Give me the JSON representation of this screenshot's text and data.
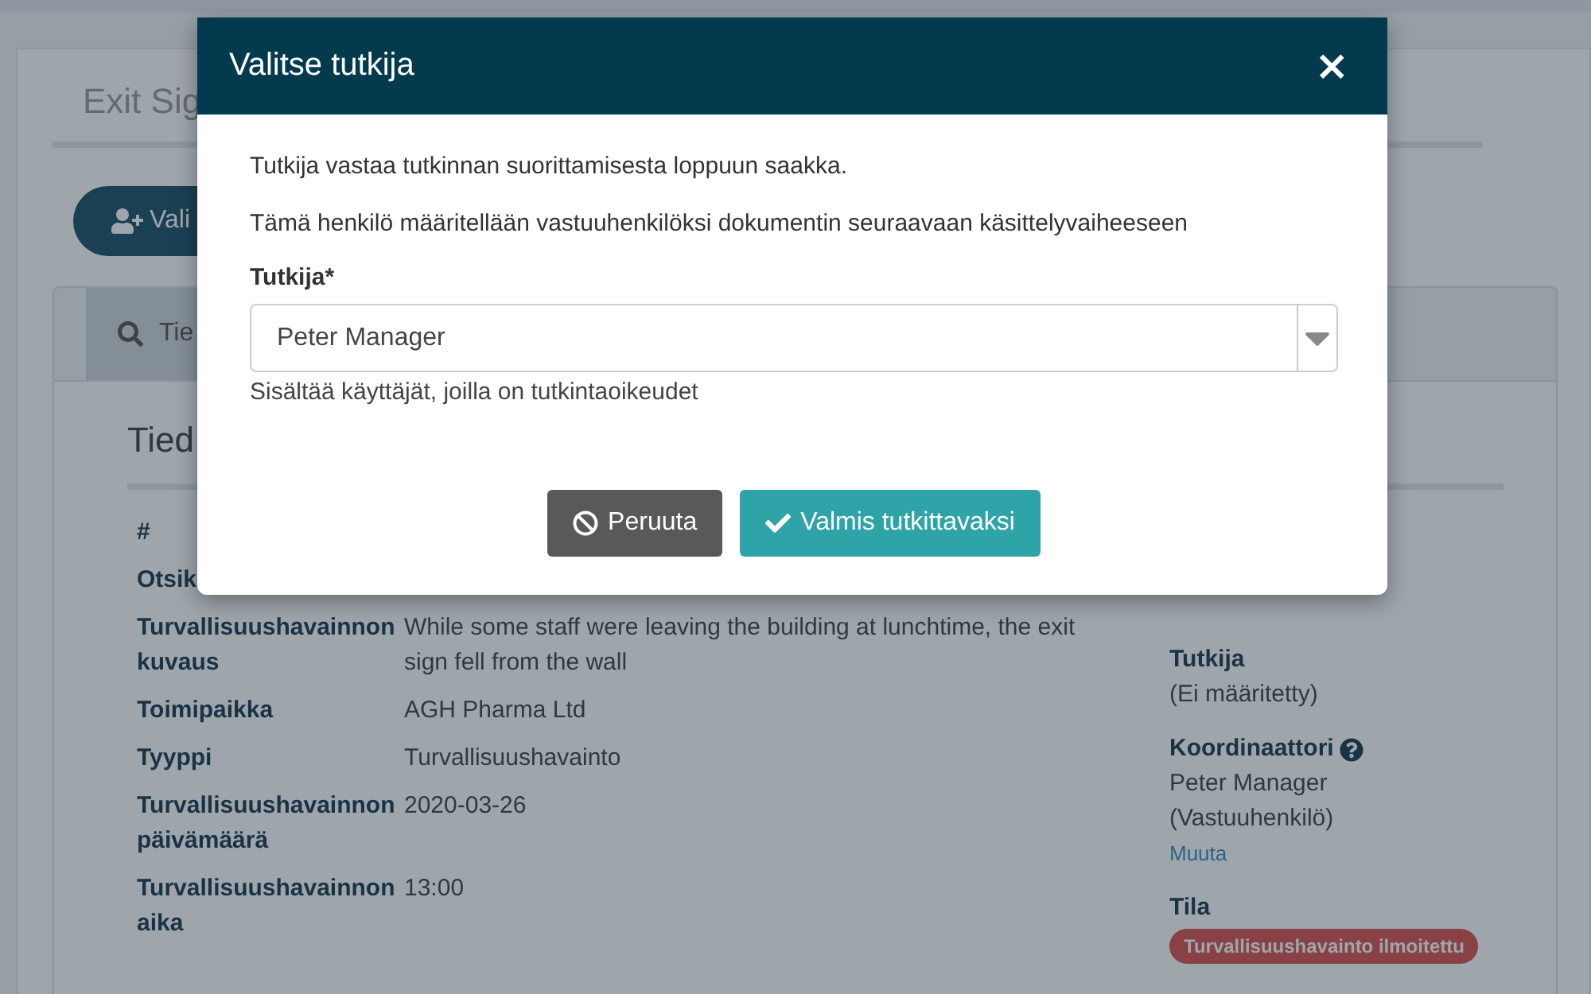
{
  "page": {
    "title": "Exit Sig",
    "action_button": "Vali",
    "tabs": [
      {
        "label": "Tie",
        "selected": true
      }
    ],
    "section_title": "Tied",
    "fields": [
      {
        "label": "#"
      },
      {
        "label": "Otsik"
      },
      {
        "label": "Turvallisuushavainnon kuvaus",
        "value": "While some staff were leaving the building at lunchtime, the exit sign fell from the wall"
      },
      {
        "label": "Toimipaikka",
        "value": "AGH Pharma Ltd"
      },
      {
        "label": "Tyyppi",
        "value": "Turvallisuushavainto"
      },
      {
        "label": "Turvallisuushavainnon päivämäärä",
        "value": "2020-03-26"
      },
      {
        "label": "Turvallisuushavainnon aika",
        "value": "13:00"
      }
    ],
    "side": [
      {
        "label": "Tutkija",
        "values": [
          "(Ei määritetty)"
        ]
      },
      {
        "label": "Koordinaattori",
        "help": true,
        "values": [
          "Peter Manager",
          "(Vastuuhenkilö)"
        ],
        "link": "Muuta"
      },
      {
        "label": "Tila",
        "badge": "Turvallisuushavainto ilmoitettu"
      }
    ]
  },
  "modal": {
    "title": "Valitse tutkija",
    "close": "×",
    "paragraphs": [
      "Tutkija vastaa tutkinnan suorittamisesta loppuun saakka.",
      "Tämä henkilö määritellään vastuuhenkilöksi dokumentin seuraavaan käsittelyvaiheeseen"
    ],
    "field": {
      "label": "Tutkija*",
      "value": "Peter Manager",
      "help": "Sisältää käyttäjät, joilla on tutkintaoikeudet"
    },
    "buttons": [
      {
        "label": "Peruuta",
        "kind": "cancel"
      },
      {
        "label": "Valmis tutkittavaksi",
        "kind": "confirm"
      }
    ]
  }
}
